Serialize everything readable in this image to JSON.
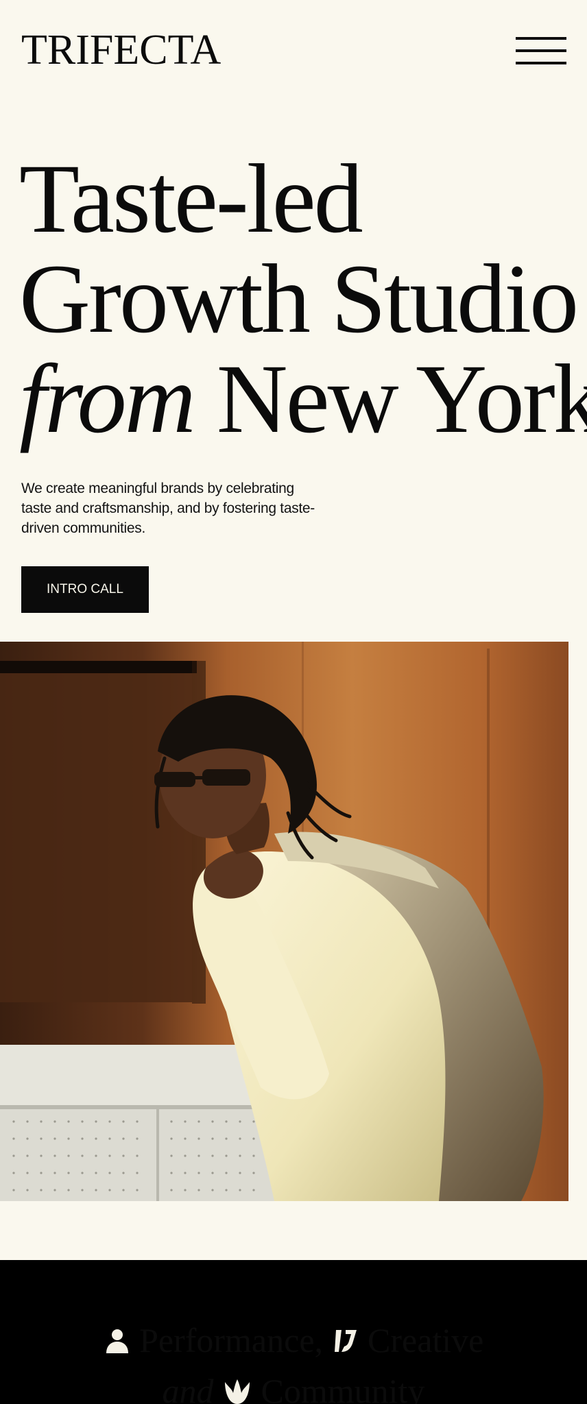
{
  "header": {
    "logo": "TRIFECTA",
    "menu_icon": "hamburger-menu-icon"
  },
  "hero": {
    "title_line1": "Taste-led",
    "title_line2": "Growth Studio",
    "title_line3_italic": "from",
    "title_line3_rest": "New York",
    "subtitle": "We create meaningful brands by celebrating taste and craftsmanship, and by fostering taste-driven communities.",
    "cta_label": "INTRO CALL"
  },
  "photo": {
    "description_icon": "portrait-photo"
  },
  "band": {
    "word1": "Performance,",
    "word2": "Creative",
    "word3_italic": "and",
    "word4": "Community",
    "icon1": "person-icon",
    "icon2": "creative-stroke-icon",
    "icon3": "crown-icon"
  },
  "colors": {
    "background": "#faf8ee",
    "text": "#0b0b0b",
    "band_background": "#000000",
    "band_text": "#f4f1e6"
  }
}
